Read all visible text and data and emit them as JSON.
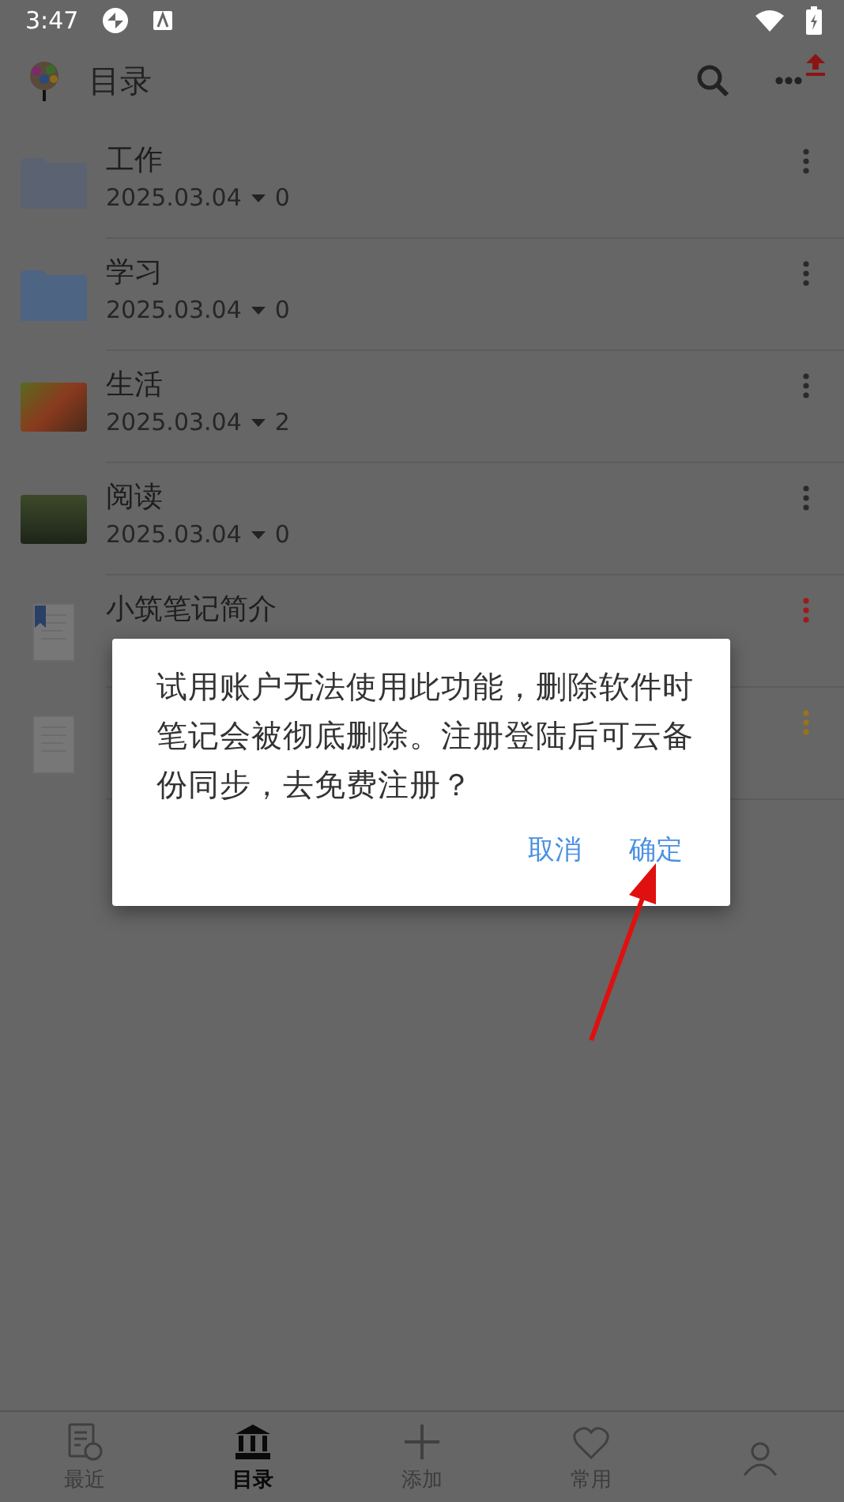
{
  "status_bar": {
    "time": "3:47"
  },
  "header": {
    "title": "目录"
  },
  "items": [
    {
      "kind": "folder",
      "title": "工作",
      "date": "2025.03.04",
      "count": "0",
      "color": "#5b6372"
    },
    {
      "kind": "folder",
      "title": "学习",
      "date": "2025.03.04",
      "count": "0",
      "color": "#4d6482"
    },
    {
      "kind": "photo",
      "title": "生活",
      "date": "2025.03.04",
      "count": "2"
    },
    {
      "kind": "photo",
      "title": "阅读",
      "date": "2025.03.04",
      "count": "0"
    },
    {
      "kind": "doc",
      "title": "小筑笔记简介",
      "color": "#a01818"
    },
    {
      "kind": "doc",
      "color": "#9a7318"
    }
  ],
  "dialog": {
    "message": "试用账户无法使用此功能，删除软件时笔记会被彻底删除。注册登陆后可云备份同步，去免费注册？",
    "buttons": [
      "取消",
      "确定"
    ]
  },
  "nav": [
    {
      "kind": "recent",
      "label": "最近",
      "selected": false
    },
    {
      "kind": "catalog",
      "label": "目录",
      "selected": true
    },
    {
      "kind": "add",
      "label": "添加",
      "selected": false
    },
    {
      "kind": "favorite",
      "label": "常用",
      "selected": false
    },
    {
      "kind": "person",
      "selected": false
    }
  ]
}
